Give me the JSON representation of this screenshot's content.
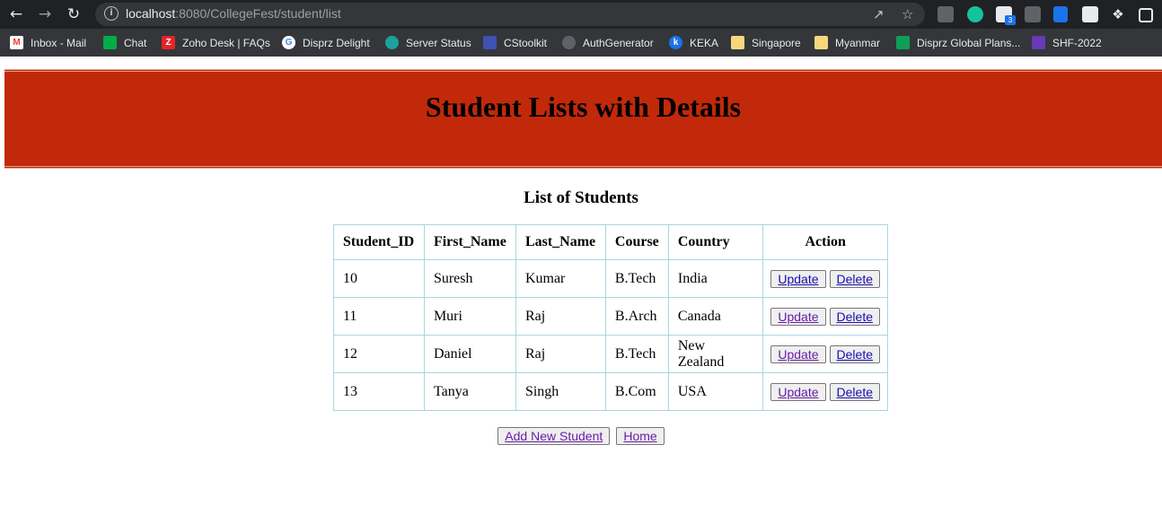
{
  "browser": {
    "url_host": "localhost",
    "url_path": ":8080/CollegeFest/student/list"
  },
  "bookmarks": [
    {
      "label": "Inbox - Mail",
      "icon": "gmail-icon",
      "color": "#ea4335"
    },
    {
      "label": "Chat",
      "icon": "chat-icon",
      "color": "#00ac47"
    },
    {
      "label": "Zoho Desk | FAQs",
      "icon": "zoho-icon",
      "color": "#e42527"
    },
    {
      "label": "Disprz Delight",
      "icon": "google-icon",
      "color": "#ffffff"
    },
    {
      "label": "Server Status",
      "icon": "server-icon",
      "color": "#1aa39a"
    },
    {
      "label": "CStoolkit",
      "icon": "toolkit-icon",
      "color": "#3f51b5"
    },
    {
      "label": "AuthGenerator",
      "icon": "globe-icon",
      "color": "#5f6368"
    },
    {
      "label": "KEKA",
      "icon": "keka-icon",
      "color": "#1a73e8"
    },
    {
      "label": "Singapore",
      "icon": "folder-icon",
      "color": "#f6d77c"
    },
    {
      "label": "Myanmar",
      "icon": "folder-icon",
      "color": "#f6d77c"
    },
    {
      "label": "Disprz Global Plans...",
      "icon": "sheets-icon",
      "color": "#0f9d58"
    },
    {
      "label": "SHF-2022",
      "icon": "forms-icon",
      "color": "#673ab7"
    }
  ],
  "extension_badge": "3",
  "page": {
    "header_title": "Student Lists with Details",
    "list_title": "List of Students",
    "header_color": "#c1290a"
  },
  "table": {
    "columns": [
      "Student_ID",
      "First_Name",
      "Last_Name",
      "Course",
      "Country",
      "Action"
    ],
    "rows": [
      {
        "id": "10",
        "first": "Suresh",
        "last": "Kumar",
        "course": "B.Tech",
        "country": "India",
        "update": "Update",
        "delete": "Delete"
      },
      {
        "id": "11",
        "first": "Muri",
        "last": "Raj",
        "course": "B.Arch",
        "country": "Canada",
        "update": "Update",
        "delete": "Delete"
      },
      {
        "id": "12",
        "first": "Daniel",
        "last": "Raj",
        "course": "B.Tech",
        "country": "New Zealand",
        "update": "Update",
        "delete": "Delete"
      },
      {
        "id": "13",
        "first": "Tanya",
        "last": "Singh",
        "course": "B.Com",
        "country": "USA",
        "update": "Update",
        "delete": "Delete"
      }
    ]
  },
  "actions": {
    "add_new": "Add New Student",
    "home": "Home"
  }
}
